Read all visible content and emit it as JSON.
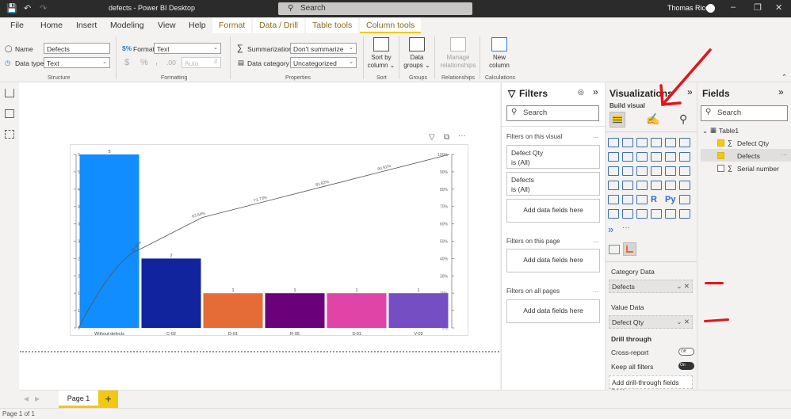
{
  "titlebar": {
    "title": "defects - Power BI Desktop",
    "search_placeholder": "Search",
    "user": "Thomas Rice"
  },
  "menu": {
    "items": [
      "File",
      "Home",
      "Insert",
      "Modeling",
      "View",
      "Help"
    ],
    "context_tabs": [
      "Format",
      "Data / Drill",
      "Table tools",
      "Column tools"
    ],
    "active_tab": "Column tools"
  },
  "ribbon": {
    "structure": {
      "name_label": "Name",
      "name_value": "Defects",
      "datatype_label": "Data type",
      "datatype_value": "Text",
      "group": "Structure"
    },
    "formatting": {
      "format_label": "Format",
      "format_value": "Text",
      "currency": "$",
      "percent": "%",
      "comma": ",",
      "decimals": "Auto",
      "group": "Formatting"
    },
    "properties": {
      "summarization_label": "Summarization",
      "summarization_value": "Don't summarize",
      "category_label": "Data category",
      "category_value": "Uncategorized",
      "group": "Properties"
    },
    "sort": {
      "label1": "Sort by",
      "label2": "column",
      "group": "Sort"
    },
    "groups": {
      "label1": "Data",
      "label2": "groups",
      "group": "Groups"
    },
    "relationships": {
      "label1": "Manage",
      "label2": "relationships",
      "group": "Relationships"
    },
    "calculations": {
      "label1": "New",
      "label2": "column",
      "group": "Calculations"
    }
  },
  "pages": {
    "tabs": [
      "Page 1"
    ],
    "add": "+",
    "status": "Page 1 of 1"
  },
  "chart_data": {
    "type": "bar",
    "title": "",
    "categories": [
      "Without defects",
      "C-02",
      "D-01",
      "R-05",
      "S-01",
      "V-02"
    ],
    "values": [
      5,
      2,
      1,
      1,
      1,
      1
    ],
    "colors": [
      "#118dff",
      "#12239e",
      "#e66c37",
      "#6b007b",
      "#e044a7",
      "#744ec2"
    ],
    "cumulative_percent": [
      45.45,
      63.64,
      72.73,
      81.82,
      90.91,
      100
    ],
    "cumulative_labels": [
      "45.45%",
      "63.64%",
      "72.73%",
      "81.82%",
      "90.91%",
      "100%"
    ],
    "y_left": {
      "range": [
        0,
        5
      ],
      "ticks": [
        "0",
        "1",
        "1",
        "2",
        "2",
        "3",
        "3",
        "4",
        "4",
        "5",
        "5"
      ]
    },
    "y_right": {
      "range": [
        0,
        100
      ],
      "ticks": [
        "0%",
        "10%",
        "20%",
        "30%",
        "40%",
        "50%",
        "60%",
        "70%",
        "80%",
        "90%",
        "100%"
      ]
    },
    "xlabel": "",
    "ylabel": "",
    "legend": "none",
    "grid": false
  },
  "filters": {
    "title": "Filters",
    "search": "Search",
    "on_visual": "Filters on this visual",
    "cards": [
      {
        "name": "Defect Qty",
        "state": "is (All)"
      },
      {
        "name": "Defects",
        "state": "is (All)"
      }
    ],
    "add": "Add data fields here",
    "on_page": "Filters on this page",
    "on_all": "Filters on all pages",
    "more": "..."
  },
  "visualizations": {
    "title": "Visualizations",
    "build": "Build visual",
    "category_label": "Category Data",
    "category_value": "Defects",
    "value_label": "Value Data",
    "value_value": "Defect Qty",
    "drill": "Drill through",
    "cross_report": "Cross-report",
    "cross_state": "Off",
    "keep_filters": "Keep all filters",
    "keep_state": "On",
    "add_drill": "Add drill-through fields here",
    "more": "..."
  },
  "fields": {
    "title": "Fields",
    "search": "Search",
    "table": "Table1",
    "items": [
      {
        "name": "Defect Qty",
        "checked": true,
        "sigma": true
      },
      {
        "name": "Defects",
        "checked": true,
        "sigma": false
      },
      {
        "name": "Serial number",
        "checked": false,
        "sigma": true
      }
    ]
  }
}
